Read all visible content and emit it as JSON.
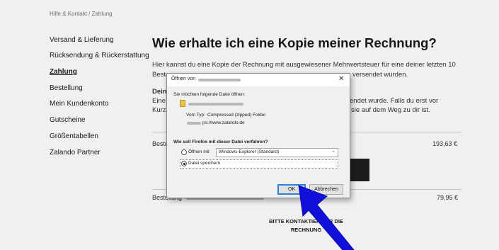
{
  "breadcrumb": "Hilfe & Kontakt  /  Zahlung",
  "nav": {
    "items": [
      {
        "label": "Versand & Lieferung"
      },
      {
        "label": "Rücksendung & Rückerstattung"
      },
      {
        "label": "Zahlung",
        "active": true
      },
      {
        "label": "Bestellung"
      },
      {
        "label": "Mein Kundenkonto"
      },
      {
        "label": "Gutscheine"
      },
      {
        "label": "Größentabellen"
      },
      {
        "label": "Zalando Partner"
      }
    ]
  },
  "main": {
    "title": "Wie erhalte ich eine Kopie meiner Rechnung?",
    "intro_line1": "Hier kannst du eine Kopie der Rechnung mit ausgewiesener Mehrwertsteuer für eine deiner letzten 10",
    "intro_line2_left": "Beste",
    "intro_line2_right": "versendet wurden.",
    "section_heading": "Dein",
    "section_line1_left": "Eine",
    "section_line1_right": "endet wurde. Falls du erst vor",
    "section_line2_left": "Kurz",
    "section_line2_right": "sie auf dem Weg zu dir ist.",
    "orders": [
      {
        "label": "Beste",
        "price": "193,63 €"
      },
      {
        "label": "Bestellung",
        "price": "79,95 €"
      }
    ],
    "contact_line1": "BITTE KONTAKTIERE       ÜR DIE",
    "contact_line2": "RECHNUNG"
  },
  "dialog": {
    "title": "Öffnen von",
    "close_glyph": "✕",
    "prompt": "Sie möchten folgende Datei öffnen:",
    "type_label": "Vom Typ:",
    "type_value": "Compressed (zipped) Folder",
    "source_suffix": "ps://www.zalando.de",
    "question": "Wie soll Firefox mit dieser Datei verfahren?",
    "open_with_label": "Öffnen mit",
    "open_with_value": "Windows-Explorer (Standard)",
    "save_label": "Datei speichern",
    "selected_option": "save",
    "ok_label": "OK",
    "cancel_label": "Abbrechen"
  },
  "annotation": {
    "arrow_color": "#1010d8",
    "arrow_icon": "arrow-up-left-icon"
  }
}
